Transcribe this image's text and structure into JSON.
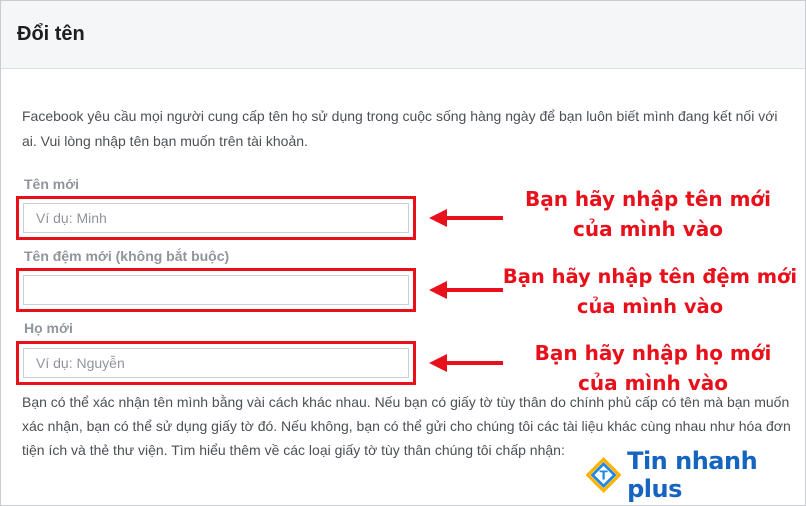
{
  "dialog": {
    "title": "Đổi tên",
    "intro": "Facebook yêu cầu mọi người cung cấp tên họ sử dụng trong cuộc sống hàng ngày để bạn luôn biết mình đang kết nối với ai. Vui lòng nhập tên bạn muốn trên tài khoản."
  },
  "fields": {
    "first_name": {
      "label": "Tên mới",
      "placeholder": "Ví dụ: Minh",
      "value": ""
    },
    "middle_name": {
      "label": "Tên đệm mới (không bắt buộc)",
      "placeholder": "",
      "value": ""
    },
    "last_name": {
      "label": "Họ mới",
      "placeholder": "Ví dụ: Nguyễn",
      "value": ""
    }
  },
  "annotations": {
    "first_line1": "Bạn hãy nhập tên mới",
    "first_line2": "của mình vào",
    "middle_line1": "Bạn hãy nhập tên đệm mới",
    "middle_line2": "của mình vào",
    "last_line1": "Bạn hãy nhập họ mới",
    "last_line2": "của mình vào"
  },
  "verification_text": "Bạn có thể xác nhận tên mình bằng vài cách khác nhau. Nếu bạn có giấy tờ tùy thân do chính phủ cấp có tên mà bạn muốn xác nhận, bạn có thể sử dụng giấy tờ đó. Nếu không, bạn có thể gửi cho chúng tôi các tài liệu khác cùng nhau như hóa đơn tiện ích và thẻ thư viện. Tìm hiểu thêm về các loại giấy tờ tùy thân chúng tôi chấp nhận:",
  "watermark": {
    "brand": "Tin nhanh plus",
    "icon": "tinnhanhplus-logo-icon"
  },
  "colors": {
    "highlight": "#e8101a",
    "brand": "#1565c0"
  }
}
